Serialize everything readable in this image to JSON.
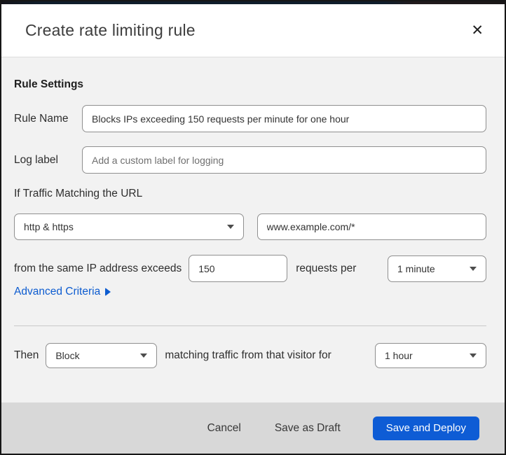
{
  "dialog": {
    "title": "Create rate limiting rule",
    "close_glyph": "✕"
  },
  "form": {
    "section_heading": "Rule Settings",
    "rule_name": {
      "label": "Rule Name",
      "value": "Blocks IPs exceeding 150 requests per minute for one hour"
    },
    "log_label": {
      "label": "Log label",
      "placeholder": "Add a custom label for logging"
    },
    "traffic_match": {
      "heading": "If Traffic Matching the URL",
      "scheme_selected": "http & https",
      "url_value": "www.example.com/*"
    },
    "rate": {
      "prefix": "from the same IP address exceeds",
      "requests_value": "150",
      "middle": "requests per",
      "period_selected": "1 minute"
    },
    "advanced_criteria_label": "Advanced Criteria",
    "then": {
      "prefix": "Then",
      "action_selected": "Block",
      "middle": "matching traffic from that visitor for",
      "duration_selected": "1 hour"
    }
  },
  "footer": {
    "cancel_label": "Cancel",
    "save_draft_label": "Save as Draft",
    "save_deploy_label": "Save and Deploy"
  },
  "colors": {
    "accent_blue": "#0e5cd5",
    "body_bg": "#f2f2f2",
    "footer_bg": "#d8d8d8",
    "input_border": "#8f8f8f"
  }
}
